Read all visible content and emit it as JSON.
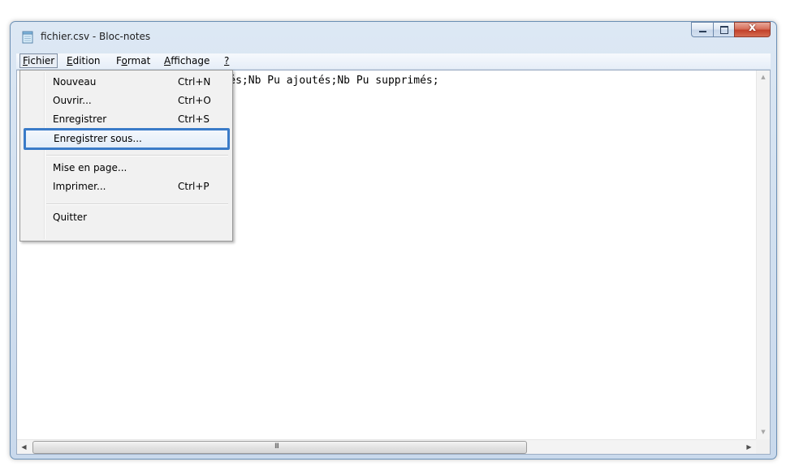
{
  "window": {
    "title": "fichier.csv - Bloc-notes",
    "close_glyph": "x"
  },
  "menubar": [
    {
      "label": "Fichier",
      "open": true
    },
    {
      "label": "Edition"
    },
    {
      "label": "Format"
    },
    {
      "label": "Affichage"
    },
    {
      "label": "?"
    }
  ],
  "editor": {
    "text": "ation;Nb Am ajoutés;Nb Am supprimés;Nb Pu ajoutés;Nb Pu supprimés;"
  },
  "file_menu": [
    {
      "label": "Nouveau",
      "shortcut": "Ctrl+N"
    },
    {
      "label": "Ouvrir...",
      "shortcut": "Ctrl+O"
    },
    {
      "label": "Enregistrer",
      "shortcut": "Ctrl+S"
    },
    {
      "label": "Enregistrer sous...",
      "shortcut": "",
      "highlighted": true
    },
    {
      "label": "Mise en page...",
      "shortcut": ""
    },
    {
      "label": "Imprimer...",
      "shortcut": "Ctrl+P"
    },
    {
      "label": "Quitter",
      "shortcut": ""
    }
  ],
  "scrollbar": {
    "grip": "III"
  },
  "colors": {
    "highlight_border": "#3a7bc8",
    "close_button": "#c2412a",
    "menu_bg": "#f1f1f1"
  }
}
